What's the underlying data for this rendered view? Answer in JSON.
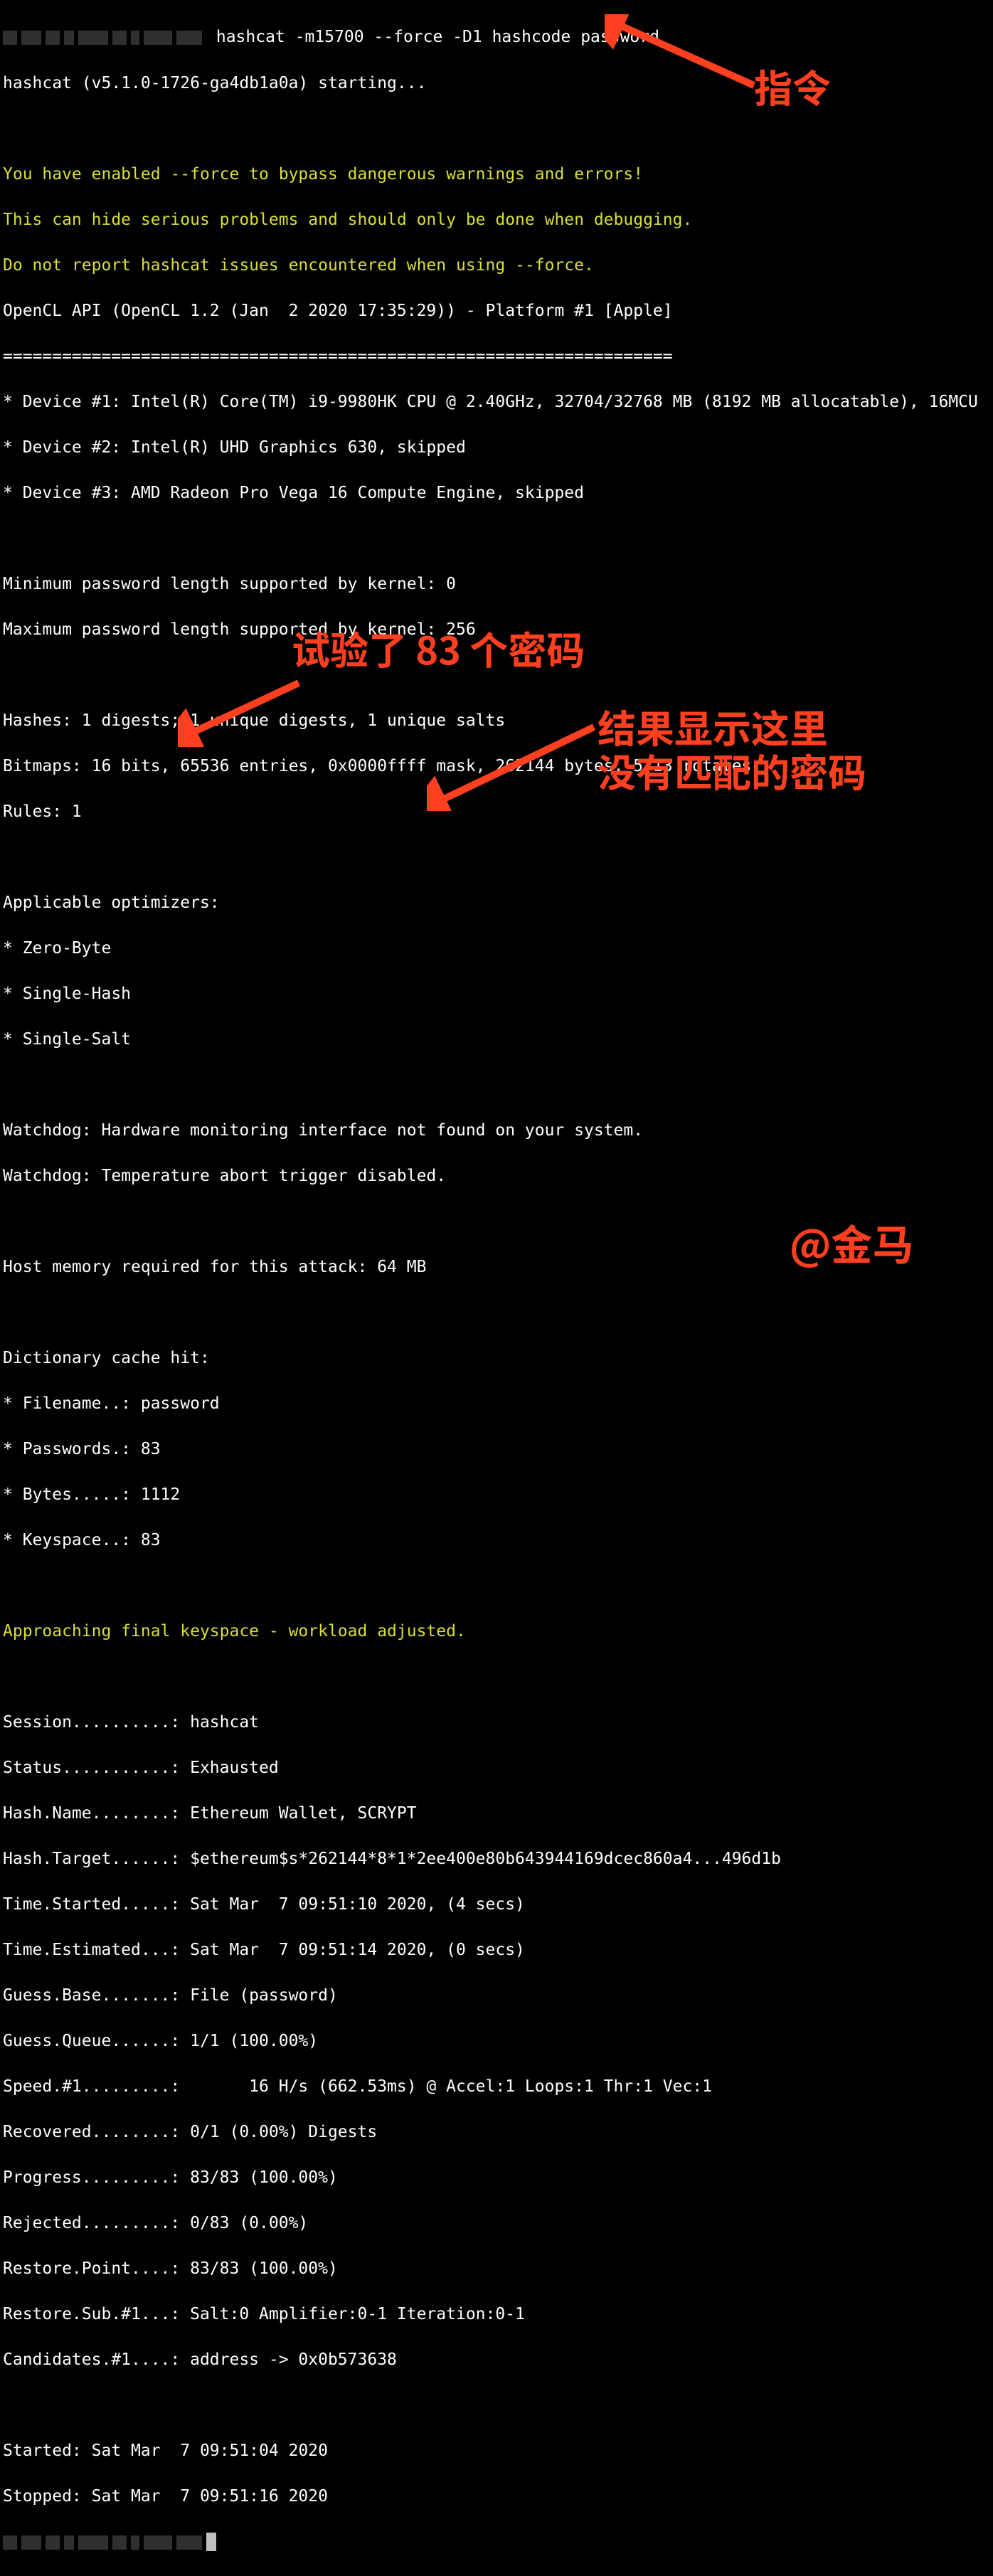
{
  "prompt_masked_widths": [
    20,
    28,
    20,
    14,
    42,
    20,
    12,
    40,
    36
  ],
  "command": " hashcat -m15700 --force -D1 hashcode password",
  "starting": "hashcat (v5.1.0-1726-ga4db1a0a) starting...",
  "warn1": "You have enabled --force to bypass dangerous warnings and errors!",
  "warn2": "This can hide serious problems and should only be done when debugging.",
  "warn3": "Do not report hashcat issues encountered when using --force.",
  "opencl": "OpenCL API (OpenCL 1.2 (Jan  2 2020 17:35:29)) - Platform #1 [Apple]",
  "sep": "====================================================================",
  "dev1": "* Device #1: Intel(R) Core(TM) i9-9980HK CPU @ 2.40GHz, 32704/32768 MB (8192 MB allocatable), 16MCU",
  "dev2": "* Device #2: Intel(R) UHD Graphics 630, skipped",
  "dev3": "* Device #3: AMD Radeon Pro Vega 16 Compute Engine, skipped",
  "minp": "Minimum password length supported by kernel: 0",
  "maxp": "Maximum password length supported by kernel: 256",
  "hashes": "Hashes: 1 digests; 1 unique digests, 1 unique salts",
  "bitmaps": "Bitmaps: 16 bits, 65536 entries, 0x0000ffff mask, 262144 bytes, 5/13 rotates",
  "rules": "Rules: 1",
  "opt_hdr": "Applicable optimizers:",
  "opt1": "* Zero-Byte",
  "opt2": "* Single-Hash",
  "opt3": "* Single-Salt",
  "wd1": "Watchdog: Hardware monitoring interface not found on your system.",
  "wd2": "Watchdog: Temperature abort trigger disabled.",
  "hostmem": "Host memory required for this attack: 64 MB",
  "dict_hdr": "Dictionary cache hit:",
  "dict_file": "* Filename..: password",
  "dict_pw": "* Passwords.: 83",
  "dict_bytes": "* Bytes.....: 1112",
  "dict_keys": "* Keyspace..: 83",
  "approach": "Approaching final keyspace - workload adjusted.",
  "s_session": "Session..........: hashcat",
  "s_status": "Status...........: Exhausted",
  "s_hashname": "Hash.Name........: Ethereum Wallet, SCRYPT",
  "s_hashtarget": "Hash.Target......: $ethereum$s*262144*8*1*2ee400e80b643944169dcec860a4...496d1b",
  "s_started": "Time.Started.....: Sat Mar  7 09:51:10 2020, (4 secs)",
  "s_estimated": "Time.Estimated...: Sat Mar  7 09:51:14 2020, (0 secs)",
  "s_guessbase": "Guess.Base.......: File (password)",
  "s_guessq": "Guess.Queue......: 1/1 (100.00%)",
  "s_speed": "Speed.#1.........:       16 H/s (662.53ms) @ Accel:1 Loops:1 Thr:1 Vec:1",
  "s_recover": "Recovered........: 0/1 (0.00%) Digests",
  "s_progress": "Progress.........: 83/83 (100.00%)",
  "s_rejected": "Rejected.........: 0/83 (0.00%)",
  "s_restorep": "Restore.Point....: 83/83 (100.00%)",
  "s_restores": "Restore.Sub.#1...: Salt:0 Amplifier:0-1 Iteration:0-1",
  "s_cand": "Candidates.#1....: address -> 0x0b573638",
  "t_started": "Started: Sat Mar  7 09:51:04 2020",
  "t_stopped": "Stopped: Sat Mar  7 09:51:16 2020",
  "annot_cmd": "指令",
  "annot_pw": "试验了 83 个密码",
  "annot_res1": "结果显示这里",
  "annot_res2": "没有匹配的密码",
  "annot_sig": "@金马"
}
